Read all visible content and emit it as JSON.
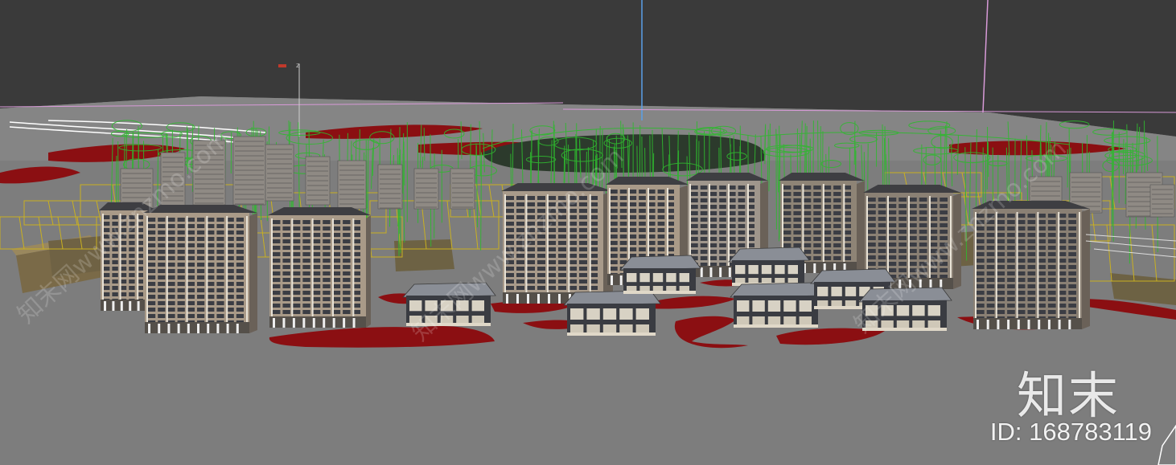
{
  "viewport": {
    "label": "3D perspective viewport",
    "gizmo_axis": "z",
    "colors": {
      "background": "#3a3a3a",
      "ground": "#7c7c7c",
      "water_red": "#8b0f12",
      "wire_green": "#2fb82f",
      "wire_yellow": "#c9b021",
      "axis_blue": "#5aa0e8",
      "axis_pink": "#d89ad8"
    }
  },
  "watermark": {
    "brand": "知末",
    "id_text": "ID: 168783119",
    "diagonal_text": "知末网www.znzmo.com"
  }
}
